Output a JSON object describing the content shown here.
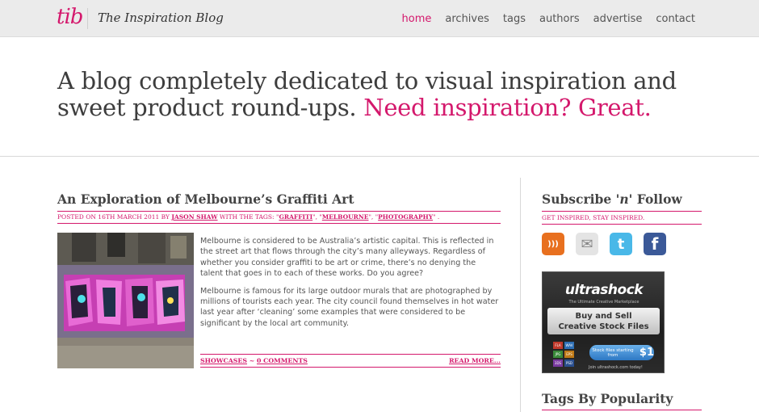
{
  "header": {
    "logo_mark": "tib",
    "site_name": "The Inspiration Blog",
    "nav": [
      "home",
      "archives",
      "tags",
      "authors",
      "advertise",
      "contact"
    ],
    "active_nav": "home"
  },
  "hero": {
    "text": "A blog completely dedicated to visual inspiration and sweet product round-ups.",
    "accent": "Need inspiration? Great."
  },
  "post": {
    "title": "An Exploration of Melbourne’s Graffiti Art",
    "meta_prefix": "Posted on 16th March 2011 by",
    "author": "Jason Shaw",
    "tags_prefix": "with the tags:",
    "tags": [
      "Graffiti",
      "Melbourne",
      "Photography"
    ],
    "paragraphs": [
      "Melbourne is considered to be Australia’s artistic capital. This is reflected in the street art that flows through the city’s many alleyways. Regardless of whether you consider graffiti to be art or crime, there’s no denying the talent that goes in to each of these works. Do you agree?",
      "Melbourne is famous for its large outdoor murals that are photographed by millions of tourists each year. The city council found themselves in hot water last year after ‘cleaning’ some examples that were considered to be significant by the local art community."
    ],
    "category": "Showcases",
    "comments": "0 Comments",
    "read_more": "Read More..."
  },
  "sidebar": {
    "subscribe_title_pre": "Subscribe",
    "subscribe_title_em": "'n'",
    "subscribe_title_post": "Follow",
    "tagline": "Get inspired, stay inspired.",
    "social": [
      {
        "name": "rss-icon",
        "glyph": ")))",
        "color": "#e8701f"
      },
      {
        "name": "email-icon",
        "glyph": "✉",
        "color": "#e4e4e4"
      },
      {
        "name": "twitter-icon",
        "glyph": "t",
        "color": "#49b8e8"
      },
      {
        "name": "facebook-icon",
        "glyph": "f",
        "color": "#3b5998"
      }
    ],
    "ad": {
      "brand": "ultrashock",
      "brand_sub": "The Ultimate Creative Marketplace",
      "line1": "Buy and Sell",
      "line2": "Creative Stock Files",
      "file_types": [
        "FLA",
        "WAV",
        "JPG",
        "EPS",
        "3DS",
        "PSD"
      ],
      "cta_small": "Stock files starting from",
      "cta_price": "$1",
      "footer": "Join ultrashock.com today!"
    },
    "tags_title": "Tags By Popularity"
  },
  "colors": {
    "accent": "#d4186c",
    "topbar": "#ebebeb",
    "text": "#444444"
  }
}
